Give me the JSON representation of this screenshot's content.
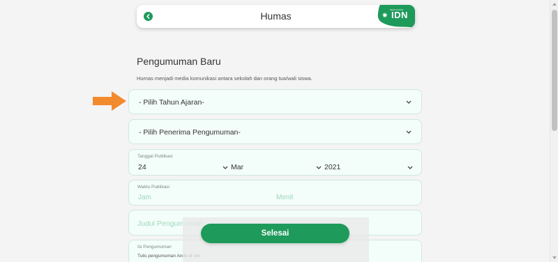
{
  "header": {
    "title": "Humas",
    "brand_small": "SEKOLAHAN",
    "brand_name": "IDN"
  },
  "form": {
    "title": "Pengumuman Baru",
    "description": "Humas menjadi media komunikasi antara sekolah dan orang tua/wali siswa.",
    "academic_year_select": "- Pilih Tahun Ajaran-",
    "recipient_select": "- Pilih Penerima Pengumuman-",
    "publish_date": {
      "label": "Tanggal Publikasi",
      "day": "24",
      "month": "Mar",
      "year": "2021"
    },
    "publish_time": {
      "label": "Waktu Publikasi",
      "hour_placeholder": "Jam",
      "minute_placeholder": "Menit"
    },
    "title_field_placeholder": "Judul Pengumuman",
    "content_field": {
      "label": "Isi Pengumuman",
      "placeholder": "Tulis pengumuman Anda di sini"
    }
  },
  "actions": {
    "finish_label": "Selesai"
  },
  "colors": {
    "primary": "#1e9a5b",
    "field_bg": "#f3fdf9",
    "field_border": "#cfe7de",
    "placeholder": "#9ed8bd",
    "annotation_arrow": "#f28a2e"
  }
}
